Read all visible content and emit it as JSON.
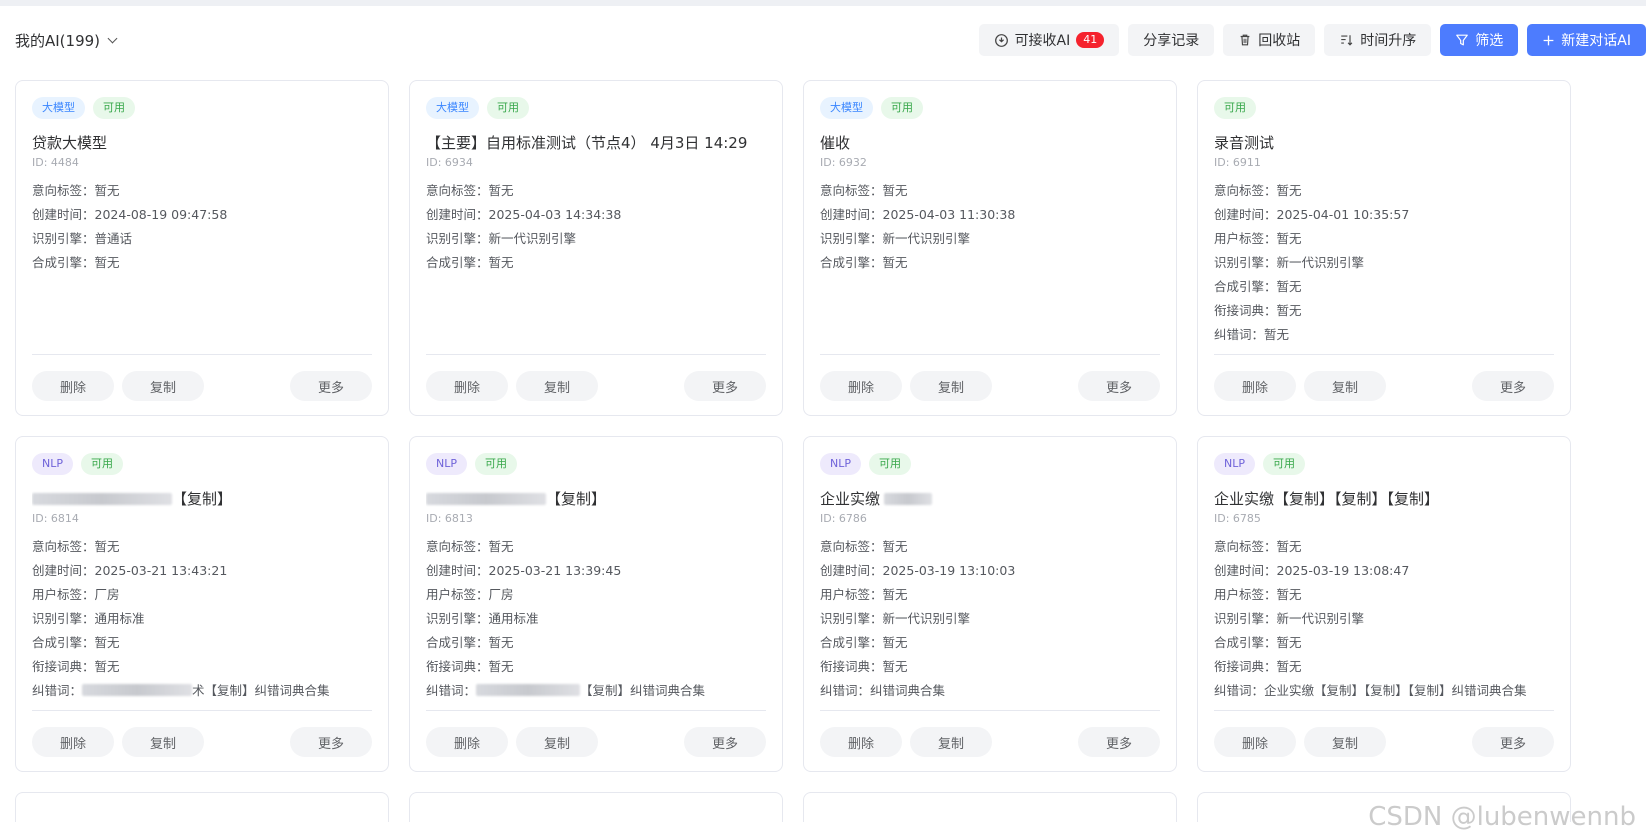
{
  "header": {
    "my_ai_label": "我的AI(199)",
    "toolbar": {
      "receivable": {
        "label": "可接收AI",
        "badge": "41"
      },
      "share": "分享记录",
      "recycle": "回收站",
      "sort": "时间升序",
      "filter": "筛选",
      "new_ai": "新建对话AI"
    }
  },
  "card_actions": {
    "delete": "删除",
    "copy": "复制",
    "more": "更多"
  },
  "cards": [
    {
      "tags": [
        {
          "text": "大模型",
          "color": "blue"
        },
        {
          "text": "可用",
          "color": "green"
        }
      ],
      "title": "贷款大模型",
      "id": "ID: 4484",
      "fields": [
        {
          "k": "意向标签：",
          "v": "暂无"
        },
        {
          "k": "创建时间：",
          "v": "2024-08-19 09:47:58"
        },
        {
          "k": "识别引擎：",
          "v": "普通话"
        },
        {
          "k": "合成引擎：",
          "v": "暂无"
        }
      ]
    },
    {
      "tags": [
        {
          "text": "大模型",
          "color": "blue"
        },
        {
          "text": "可用",
          "color": "green"
        }
      ],
      "title": "【主要】自用标准测试（节点4） 4月3日 14:29",
      "id": "ID: 6934",
      "fields": [
        {
          "k": "意向标签：",
          "v": "暂无"
        },
        {
          "k": "创建时间：",
          "v": "2025-04-03 14:34:38"
        },
        {
          "k": "识别引擎：",
          "v": "新一代识别引擎"
        },
        {
          "k": "合成引擎：",
          "v": "暂无"
        }
      ]
    },
    {
      "tags": [
        {
          "text": "大模型",
          "color": "blue"
        },
        {
          "text": "可用",
          "color": "green"
        }
      ],
      "title": "催收",
      "id": "ID: 6932",
      "fields": [
        {
          "k": "意向标签：",
          "v": "暂无"
        },
        {
          "k": "创建时间：",
          "v": "2025-04-03 11:30:38"
        },
        {
          "k": "识别引擎：",
          "v": "新一代识别引擎"
        },
        {
          "k": "合成引擎：",
          "v": "暂无"
        }
      ]
    },
    {
      "tags": [
        {
          "text": "可用",
          "color": "green"
        }
      ],
      "title": "录音测试",
      "id": "ID: 6911",
      "fields": [
        {
          "k": "意向标签：",
          "v": "暂无"
        },
        {
          "k": "创建时间：",
          "v": "2025-04-01 10:35:57"
        },
        {
          "k": "用户标签：",
          "v": "暂无"
        },
        {
          "k": "识别引擎：",
          "v": "新一代识别引擎"
        },
        {
          "k": "合成引擎：",
          "v": "暂无"
        },
        {
          "k": "衔接词典：",
          "v": "暂无"
        },
        {
          "k": "纠错词：",
          "v": "暂无"
        }
      ]
    },
    {
      "tags": [
        {
          "text": "NLP",
          "color": "purple"
        },
        {
          "text": "可用",
          "color": "green"
        }
      ],
      "title": "【复制】",
      "title_blur_before": 140,
      "id": "ID: 6814",
      "fields": [
        {
          "k": "意向标签：",
          "v": "暂无"
        },
        {
          "k": "创建时间：",
          "v": "2025-03-21 13:43:21"
        },
        {
          "k": "用户标签：",
          "v": "厂房"
        },
        {
          "k": "识别引擎：",
          "v": "通用标准"
        },
        {
          "k": "合成引擎：",
          "v": "暂无"
        },
        {
          "k": "衔接词典：",
          "v": "暂无"
        },
        {
          "k": "纠错词：",
          "v": "术【复制】纠错词典合集",
          "blur": 110
        }
      ]
    },
    {
      "tags": [
        {
          "text": "NLP",
          "color": "purple"
        },
        {
          "text": "可用",
          "color": "green"
        }
      ],
      "title": "【复制】",
      "title_blur_before": 120,
      "id": "ID: 6813",
      "fields": [
        {
          "k": "意向标签：",
          "v": "暂无"
        },
        {
          "k": "创建时间：",
          "v": "2025-03-21 13:39:45"
        },
        {
          "k": "用户标签：",
          "v": "厂房"
        },
        {
          "k": "识别引擎：",
          "v": "通用标准"
        },
        {
          "k": "合成引擎：",
          "v": "暂无"
        },
        {
          "k": "衔接词典：",
          "v": "暂无"
        },
        {
          "k": "纠错词：",
          "v": "【复制】纠错词典合集",
          "blur": 104
        }
      ]
    },
    {
      "tags": [
        {
          "text": "NLP",
          "color": "purple"
        },
        {
          "text": "可用",
          "color": "green"
        }
      ],
      "title": "企业实缴",
      "title_blur_after": 48,
      "id": "ID: 6786",
      "fields": [
        {
          "k": "意向标签：",
          "v": "暂无"
        },
        {
          "k": "创建时间：",
          "v": "2025-03-19 13:10:03"
        },
        {
          "k": "用户标签：",
          "v": "暂无"
        },
        {
          "k": "识别引擎：",
          "v": "新一代识别引擎"
        },
        {
          "k": "合成引擎：",
          "v": "暂无"
        },
        {
          "k": "衔接词典：",
          "v": "暂无"
        },
        {
          "k": "纠错词：",
          "v": "纠错词典合集"
        }
      ]
    },
    {
      "tags": [
        {
          "text": "NLP",
          "color": "purple"
        },
        {
          "text": "可用",
          "color": "green"
        }
      ],
      "title": "企业实缴【复制】【复制】【复制】",
      "id": "ID: 6785",
      "fields": [
        {
          "k": "意向标签：",
          "v": "暂无"
        },
        {
          "k": "创建时间：",
          "v": "2025-03-19 13:08:47"
        },
        {
          "k": "用户标签：",
          "v": "暂无"
        },
        {
          "k": "识别引擎：",
          "v": "新一代识别引擎"
        },
        {
          "k": "合成引擎：",
          "v": "暂无"
        },
        {
          "k": "衔接词典：",
          "v": "暂无"
        },
        {
          "k": "纠错词：",
          "v": "企业实缴【复制】【复制】【复制】纠错词典合集"
        }
      ]
    }
  ],
  "watermark": "CSDN @lubenwennb"
}
